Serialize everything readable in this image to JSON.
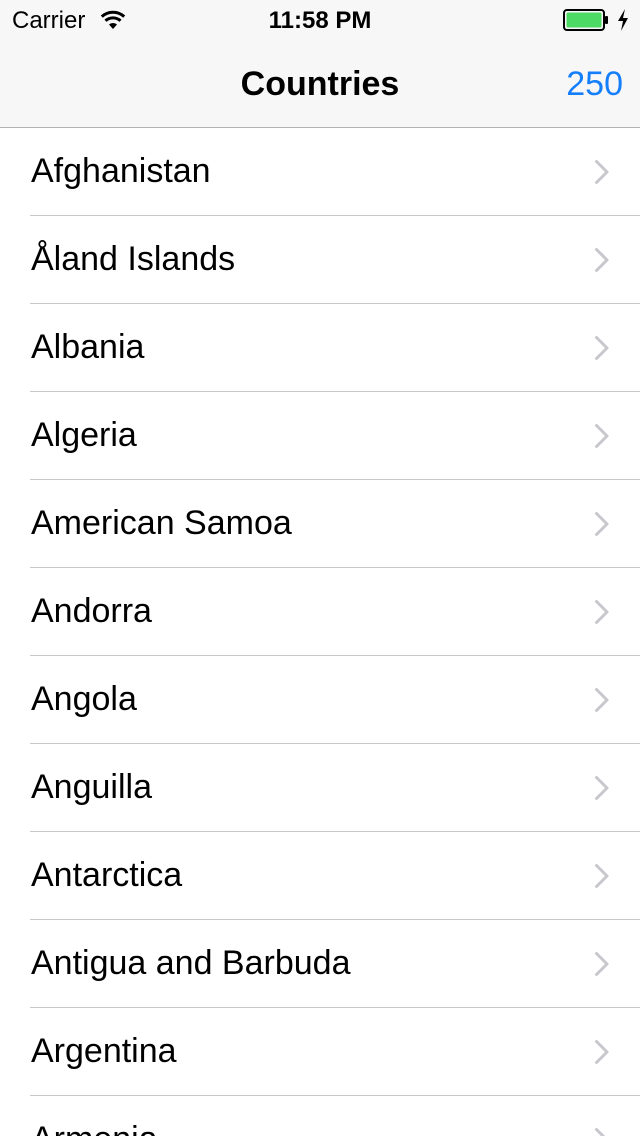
{
  "status_bar": {
    "carrier": "Carrier",
    "time": "11:58 PM",
    "battery_color": "#4cd964"
  },
  "nav_bar": {
    "title": "Countries",
    "count": "250",
    "accent_color": "#157efb"
  },
  "countries": [
    {
      "label": "Afghanistan"
    },
    {
      "label": "Åland Islands"
    },
    {
      "label": "Albania"
    },
    {
      "label": "Algeria"
    },
    {
      "label": "American Samoa"
    },
    {
      "label": "Andorra"
    },
    {
      "label": "Angola"
    },
    {
      "label": "Anguilla"
    },
    {
      "label": "Antarctica"
    },
    {
      "label": "Antigua and Barbuda"
    },
    {
      "label": "Argentina"
    },
    {
      "label": "Armenia"
    }
  ],
  "icons": {
    "row_accessory": "chevron-right-icon",
    "status_wifi": "wifi-icon",
    "status_battery": "battery-icon",
    "status_charging": "charging-bolt-icon"
  }
}
